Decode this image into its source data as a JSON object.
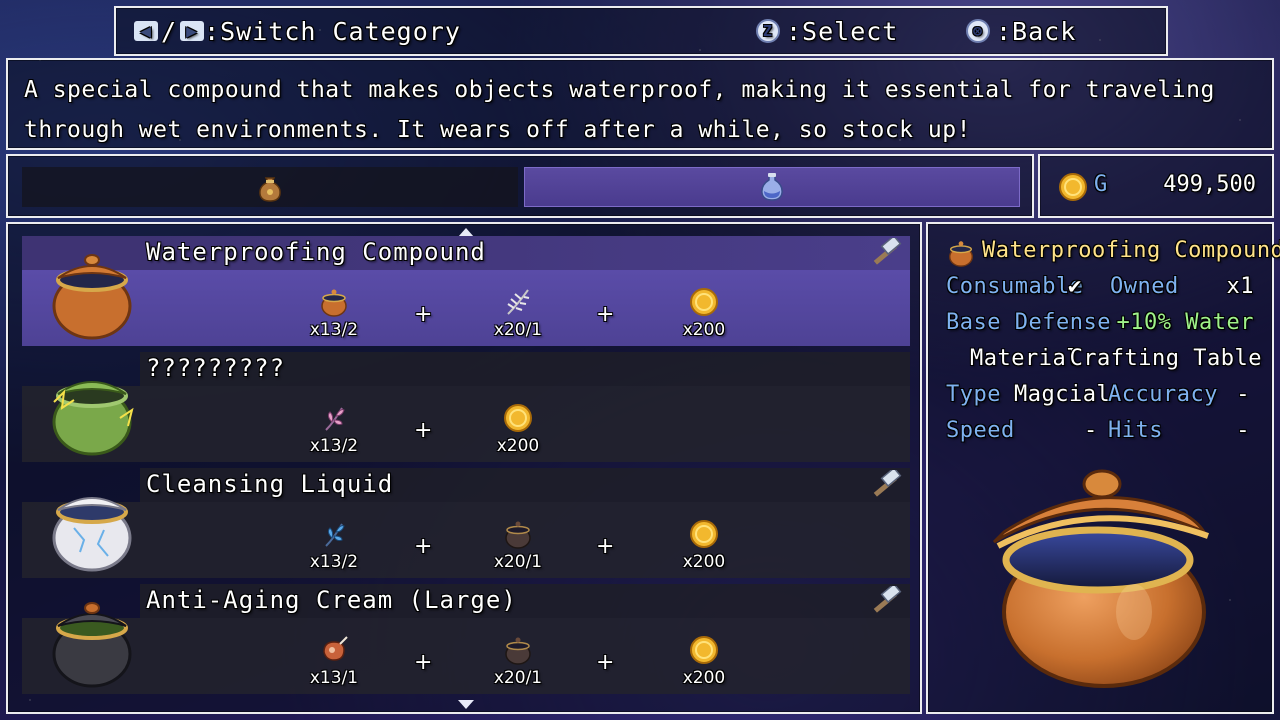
{
  "hints": {
    "switch_label": ":Switch Category",
    "select_key": "Z",
    "select_label": ":Select",
    "back_key": "⊗",
    "back_label": ":Back"
  },
  "description": "A special compound that makes objects waterproof, making it essential for traveling through wet environments. It wears off after a while, so stock up!",
  "categories": [
    {
      "icon": "pouch-icon",
      "active": false
    },
    {
      "icon": "potion-icon",
      "active": true
    }
  ],
  "gold": {
    "label": "G",
    "amount": "499,500"
  },
  "recipes": [
    {
      "name": "Waterproofing Compound",
      "icon": "brown-pot-icon",
      "selected": true,
      "craftable": true,
      "ingredients": [
        {
          "icon": "brown-pot-icon",
          "qty": "x13/2"
        },
        {
          "icon": "feather-herb-icon",
          "qty": "x20/1"
        },
        {
          "icon": "gold-coin-icon",
          "qty": "x200"
        }
      ]
    },
    {
      "name": "?????????",
      "icon": "green-pot-icon",
      "selected": false,
      "craftable": false,
      "ingredients": [
        {
          "icon": "pink-herb-icon",
          "qty": "x13/2"
        },
        {
          "icon": "gold-coin-icon",
          "qty": "x200"
        }
      ]
    },
    {
      "name": "Cleansing Liquid",
      "icon": "white-pot-icon",
      "selected": false,
      "craftable": true,
      "ingredients": [
        {
          "icon": "blue-herb-icon",
          "qty": "x13/2"
        },
        {
          "icon": "dark-pot-icon",
          "qty": "x20/1"
        },
        {
          "icon": "gold-coin-icon",
          "qty": "x200"
        }
      ]
    },
    {
      "name": "Anti-Aging Cream (Large)",
      "icon": "black-pot-icon",
      "selected": false,
      "craftable": true,
      "ingredients": [
        {
          "icon": "meat-icon",
          "qty": "x13/1"
        },
        {
          "icon": "dark-pot-icon",
          "qty": "x20/1"
        },
        {
          "icon": "gold-coin-icon",
          "qty": "x200"
        }
      ]
    }
  ],
  "detail": {
    "name": "Waterproofing Compound",
    "consumable_label": "Consumable",
    "consumable_check": "✔",
    "owned_label": "Owned",
    "owned_value": "x1",
    "base_label": "Base Defense",
    "base_value": "+10% Water",
    "material_label": "Material",
    "material_value": "Crafting Table",
    "type_label": "Type",
    "type_value": "Magcial",
    "accuracy_label": "Accuracy",
    "accuracy_value": "-",
    "speed_label": "Speed",
    "speed_value": "-",
    "hits_label": "Hits",
    "hits_value": "-"
  },
  "colors": {
    "selected_row": "#4e4295",
    "label_blue": "#7fb2f0",
    "item_name_gold": "#ffe38a",
    "bonus_green": "#9ff28a"
  }
}
